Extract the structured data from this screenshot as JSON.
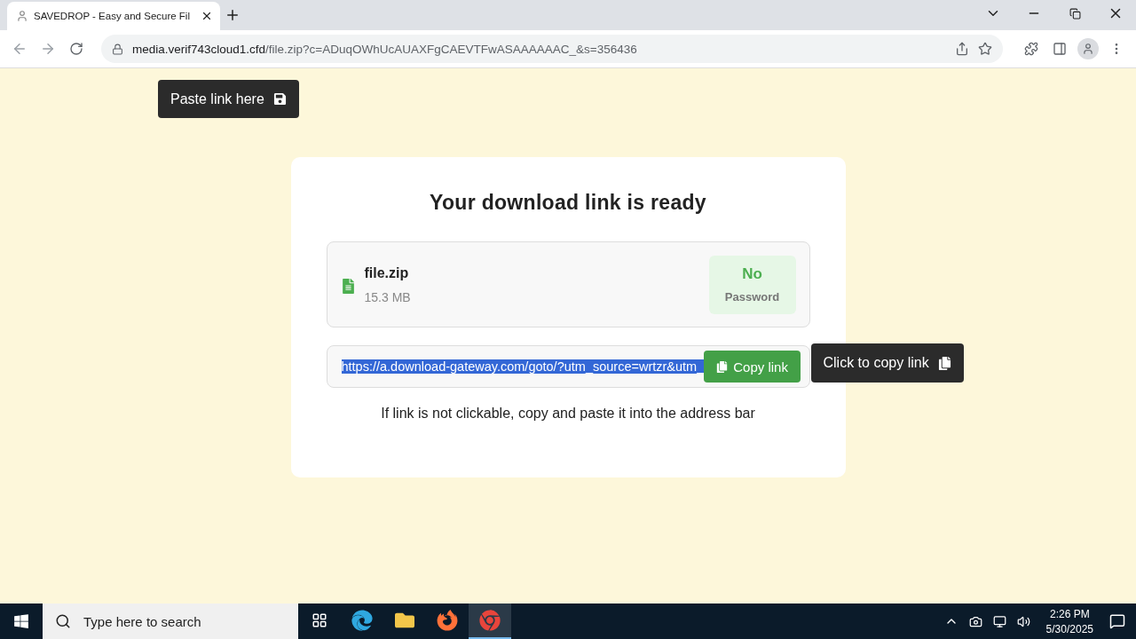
{
  "browser": {
    "tab": {
      "title": "SAVEDROP - Easy and Secure Fil",
      "selected": true
    },
    "address": {
      "host": "media.verif743cloud1.cfd",
      "path": "/file.zip?c=ADuqOWhUcAUAXFgCAEVTFwASAAAAAAC_&s=356436"
    }
  },
  "page": {
    "paste_tooltip": "Paste link here",
    "heading": "Your download link is ready",
    "file": {
      "name": "file.zip",
      "size": "15.3 MB"
    },
    "password_badge": {
      "value": "No",
      "label": "Password"
    },
    "link": {
      "value": "https://a.download-gateway.com/goto/?utm_source=wrtzr&utm_",
      "selected": true
    },
    "copy_button": "Copy link",
    "copy_tooltip": "Click to copy link",
    "hint": "If link is not clickable, copy and paste it into the address bar"
  },
  "taskbar": {
    "search_placeholder": "Type here to search",
    "apps": [
      {
        "kind": "task-view",
        "selected": false
      },
      {
        "kind": "edge",
        "selected": false
      },
      {
        "kind": "explorer",
        "selected": false
      },
      {
        "kind": "firefox",
        "selected": false
      },
      {
        "kind": "chrome",
        "selected": true
      }
    ],
    "time": "2:26 PM",
    "date": "5/30/2025"
  }
}
